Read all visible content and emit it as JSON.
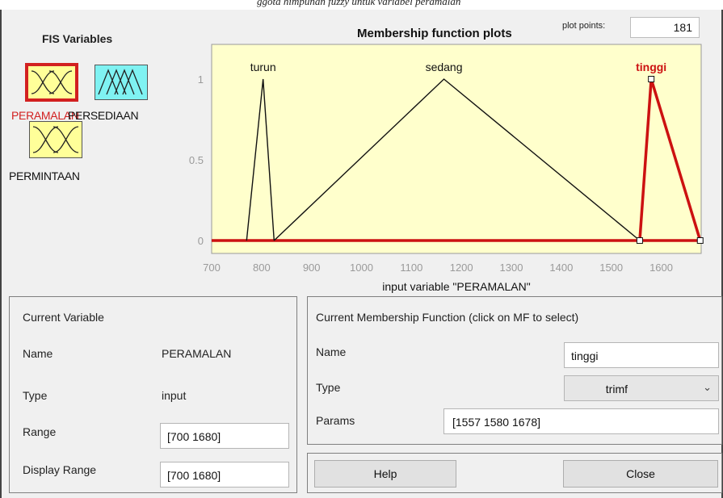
{
  "caption_fragment": "ggota himpunan fuzzy untuk variabel peramalan",
  "fis_variables": {
    "title": "FIS Variables",
    "items": [
      {
        "name": "PERAMALAN",
        "selected": true,
        "fill": "#ffff99"
      },
      {
        "name": "PERSEDIAAN",
        "selected": false,
        "fill": "#7ff2f2"
      },
      {
        "name": "PERMINTAAN",
        "selected": false,
        "fill": "#ffff99"
      }
    ]
  },
  "plot": {
    "title": "Membership function plots",
    "plot_points_label": "plot points:",
    "plot_points": "181",
    "xlabel": "input variable \"PERAMALAN\"",
    "x_ticks": [
      "700",
      "800",
      "900",
      "1000",
      "1100",
      "1200",
      "1300",
      "1400",
      "1500",
      "1600"
    ],
    "y_ticks": [
      "0",
      "0.5",
      "1"
    ],
    "background": "#ffffcc",
    "selected_color": "#cc1111"
  },
  "chart_data": {
    "type": "line",
    "title": "Membership function plots",
    "xlabel": "input variable \"PERAMALAN\"",
    "ylabel": "",
    "xlim": [
      700,
      1680
    ],
    "ylim": [
      0,
      1
    ],
    "series": [
      {
        "name": "turun",
        "x": [
          770,
          803,
          825
        ],
        "y": [
          0,
          1,
          0
        ]
      },
      {
        "name": "sedang",
        "x": [
          825,
          1165,
          1557
        ],
        "y": [
          0,
          1,
          0
        ]
      },
      {
        "name": "tinggi",
        "x": [
          1557,
          1580,
          1678
        ],
        "y": [
          0,
          1,
          0
        ]
      }
    ],
    "selected_series": "tinggi"
  },
  "current_variable": {
    "title": "Current Variable",
    "name_label": "Name",
    "name_value": "PERAMALAN",
    "type_label": "Type",
    "type_value": "input",
    "range_label": "Range",
    "range_value": "[700 1680]",
    "display_range_label": "Display Range",
    "display_range_value": "[700 1680]"
  },
  "current_mf": {
    "title": "Current Membership Function (click on MF to select)",
    "name_label": "Name",
    "name_value": "tinggi",
    "type_label": "Type",
    "type_value": "trimf",
    "params_label": "Params",
    "params_value": "[1557 1580 1678]"
  },
  "buttons": {
    "help": "Help",
    "close": "Close"
  }
}
